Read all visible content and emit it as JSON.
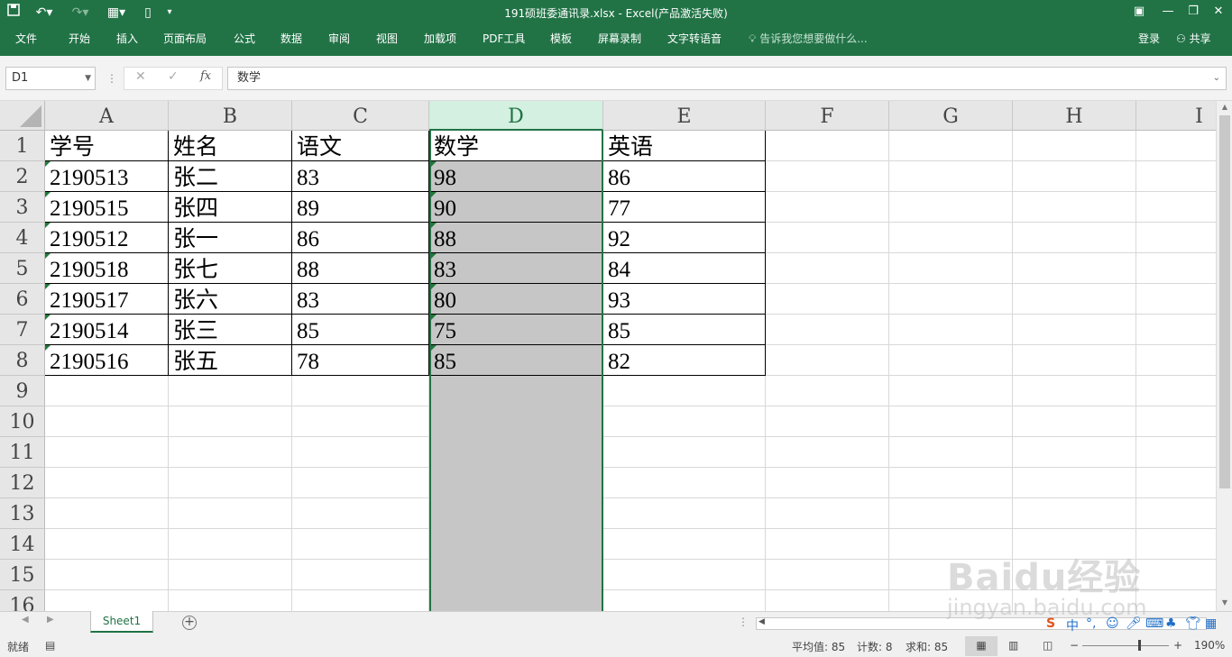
{
  "titlebar": {
    "title": "191硕班委通讯录.xlsx - Excel(产品激活失败)",
    "qa_icons": [
      "save-icon",
      "undo-icon",
      "redo-icon",
      "layout-icon",
      "new-file-icon",
      "customize-icon"
    ]
  },
  "ribbon": {
    "tabs": [
      "文件",
      "开始",
      "插入",
      "页面布局",
      "公式",
      "数据",
      "审阅",
      "视图",
      "加载项",
      "PDF工具",
      "模板",
      "屏幕录制",
      "文字转语音"
    ],
    "tell_me": "告诉我您想要做什么...",
    "login": "登录",
    "share": "共享"
  },
  "formula_bar": {
    "name_box": "D1",
    "formula": "数学"
  },
  "grid": {
    "columns": [
      "A",
      "B",
      "C",
      "D",
      "E",
      "F",
      "G",
      "H",
      "I"
    ],
    "rows": [
      "1",
      "2",
      "3",
      "4",
      "5",
      "6",
      "7",
      "8",
      "9",
      "10",
      "11",
      "12",
      "13",
      "14",
      "15",
      "16"
    ],
    "selected_column": "D",
    "table": {
      "headers": [
        "学号",
        "姓名",
        "语文",
        "数学",
        "英语"
      ],
      "records": [
        [
          "2190513",
          "张二",
          "83",
          "98",
          "86"
        ],
        [
          "2190515",
          "张四",
          "89",
          "90",
          "77"
        ],
        [
          "2190512",
          "张一",
          "86",
          "88",
          "92"
        ],
        [
          "2190518",
          "张七",
          "88",
          "83",
          "84"
        ],
        [
          "2190517",
          "张六",
          "83",
          "80",
          "93"
        ],
        [
          "2190514",
          "张三",
          "85",
          "75",
          "85"
        ],
        [
          "2190516",
          "张五",
          "78",
          "85",
          "82"
        ]
      ]
    }
  },
  "sheets": {
    "tabs": [
      "Sheet1"
    ],
    "active": "Sheet1"
  },
  "status": {
    "mode": "就绪",
    "average": "平均值: 85",
    "count": "计数: 8",
    "sum": "求和: 85",
    "zoom": "190%"
  },
  "watermark": {
    "brand": "Baidu经验",
    "url": "jingyan.baidu.com"
  },
  "colors": {
    "excel_green": "#217346",
    "selection_fill": "#c6c6c6",
    "header_selected": "#d3f0e0"
  }
}
